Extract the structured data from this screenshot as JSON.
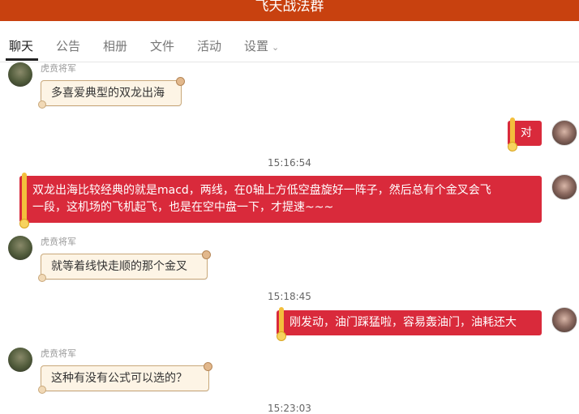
{
  "header": {
    "title": "飞天战法群"
  },
  "tabs": [
    {
      "label": "聊天",
      "active": true
    },
    {
      "label": "公告"
    },
    {
      "label": "相册"
    },
    {
      "label": "文件"
    },
    {
      "label": "活动"
    },
    {
      "label": "设置"
    }
  ],
  "messages": [
    {
      "sender": "虎贲将军",
      "text": "多喜爱典型的双龙出海"
    },
    {
      "text": "对"
    },
    {
      "text": "双龙出海比较经典的就是macd，两线，在0轴上方低空盘旋好一阵子，然后总有个金叉会飞"
    },
    {
      "text": "一段，这机场的飞机起飞，也是在空中盘一下，才提速~~~"
    },
    {
      "sender": "虎贲将军",
      "text": "就等着线快走顺的那个金叉"
    },
    {
      "text": "刚发动，油门踩猛啦，容易轰油门，油耗还大"
    },
    {
      "sender": "虎贲将军",
      "text": "这种有没有公式可以选的？"
    }
  ],
  "timestamps": [
    "15:16:54",
    "15:18:45",
    "15:23:03"
  ],
  "colors": {
    "header": "#c8410f",
    "outgoing_bubble": "#d92a3b",
    "incoming_bubble": "#fdf4e5"
  }
}
